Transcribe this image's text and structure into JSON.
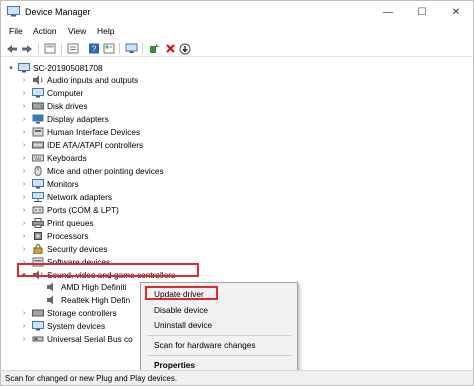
{
  "window": {
    "title": "Device Manager",
    "controls": {
      "minimize": "—",
      "maximize": "☐",
      "close": "✕"
    }
  },
  "menu": [
    "File",
    "Action",
    "View",
    "Help"
  ],
  "toolbar_icons": [
    "back-arrow-icon",
    "forward-arrow-icon",
    "computer-view-icon",
    "properties-icon",
    "help-icon",
    "device-list-icon",
    "monitor-icon",
    "add-driver-icon",
    "remove-x-icon",
    "download-icon"
  ],
  "tree": {
    "root": "SC-201905081708",
    "categories": [
      {
        "label": "Audio inputs and outputs",
        "icon": "speaker-icon"
      },
      {
        "label": "Computer",
        "icon": "computer-icon"
      },
      {
        "label": "Disk drives",
        "icon": "disk-icon"
      },
      {
        "label": "Display adapters",
        "icon": "display-icon"
      },
      {
        "label": "Human Interface Devices",
        "icon": "hid-icon"
      },
      {
        "label": "IDE ATA/ATAPI controllers",
        "icon": "ide-icon"
      },
      {
        "label": "Keyboards",
        "icon": "keyboard-icon"
      },
      {
        "label": "Mice and other pointing devices",
        "icon": "mouse-icon"
      },
      {
        "label": "Monitors",
        "icon": "monitor-icon"
      },
      {
        "label": "Network adapters",
        "icon": "network-icon"
      },
      {
        "label": "Ports (COM & LPT)",
        "icon": "port-icon"
      },
      {
        "label": "Print queues",
        "icon": "printer-icon"
      },
      {
        "label": "Processors",
        "icon": "processor-icon"
      },
      {
        "label": "Security devices",
        "icon": "security-icon"
      },
      {
        "label": "Software devices",
        "icon": "software-icon"
      },
      {
        "label": "Sound, video and game controllers",
        "icon": "sound-icon"
      },
      {
        "label": "AMD High Definiti",
        "icon": "audio-device-icon"
      },
      {
        "label": "Realtek High Defin",
        "icon": "audio-device-icon"
      },
      {
        "label": "Storage controllers",
        "icon": "storage-icon"
      },
      {
        "label": "System devices",
        "icon": "system-icon"
      },
      {
        "label": "Universal Serial Bus co",
        "icon": "usb-icon"
      }
    ]
  },
  "context_menu": {
    "items": [
      "Update driver",
      "Disable device",
      "Uninstall device",
      "Scan for hardware changes",
      "Properties"
    ]
  },
  "status": "Scan for changed or new Plug and Play devices.",
  "colors": {
    "highlight": "#e0282e",
    "accent": "#1f6fc5"
  }
}
